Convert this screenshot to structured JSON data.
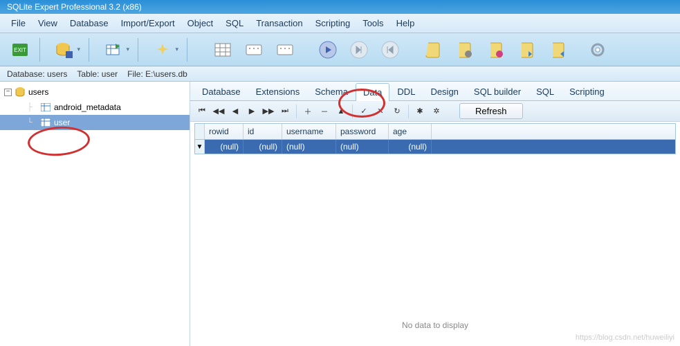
{
  "title": "SQLite Expert Professional 3.2 (x86)",
  "menus": [
    "File",
    "View",
    "Database",
    "Import/Export",
    "Object",
    "SQL",
    "Transaction",
    "Scripting",
    "Tools",
    "Help"
  ],
  "status": {
    "db_label": "Database:",
    "db": "users",
    "tbl_label": "Table:",
    "tbl": "user",
    "file_label": "File:",
    "file": "E:\\users.db"
  },
  "tree": {
    "root": "users",
    "children": [
      {
        "label": "android_metadata",
        "selected": false
      },
      {
        "label": "user",
        "selected": true
      }
    ]
  },
  "tabs": [
    "Database",
    "Extensions",
    "Schema",
    "Data",
    "DDL",
    "Design",
    "SQL builder",
    "SQL",
    "Scripting"
  ],
  "active_tab": "Data",
  "nav_buttons": [
    "⏮",
    "◀◀",
    "◀",
    "▶",
    "▶▶",
    "⏭",
    "＋",
    "－",
    "▲",
    "✓",
    "✕",
    "↻",
    "✱",
    "✲"
  ],
  "refresh_label": "Refresh",
  "columns": [
    {
      "key": "rowid",
      "label": "rowid"
    },
    {
      "key": "id",
      "label": "id"
    },
    {
      "key": "username",
      "label": "username"
    },
    {
      "key": "password",
      "label": "password"
    },
    {
      "key": "age",
      "label": "age"
    }
  ],
  "rows": [
    {
      "rowid": "(null)",
      "id": "(null)",
      "username": "(null)",
      "password": "(null)",
      "age": "(null)"
    }
  ],
  "no_data_msg": "No data to display",
  "watermark": "https://blog.csdn.net/huweiliyi"
}
